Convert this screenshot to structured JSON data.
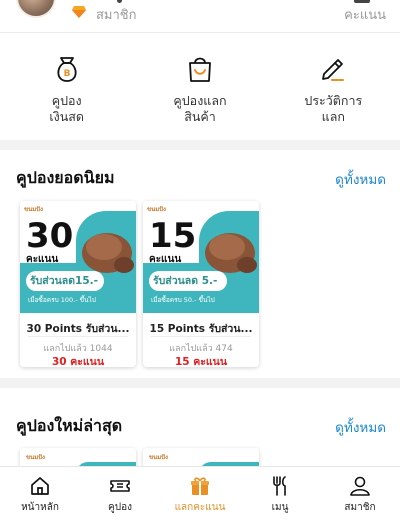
{
  "header": {
    "member_label": "สมาชิก",
    "points_label": "คะแนน"
  },
  "quick_actions": [
    {
      "line1": "คูปอง",
      "line2": "เงินสด",
      "icon": "cash-coupon-icon"
    },
    {
      "line1": "คูปองแลก",
      "line2": "สินค้า",
      "icon": "shopping-bag-icon"
    },
    {
      "line1": "ประวัติการ",
      "line2": "แลก",
      "icon": "pencil-icon"
    }
  ],
  "popular": {
    "title": "คูปองยอดนิยม",
    "see_all": "ดูทั้งหมด",
    "coupons": [
      {
        "brand": "ขนมปัง",
        "big_number": "30",
        "unit": "คะแนน",
        "discount": "รับส่วนลด15.-",
        "condition": "เมื่อซื้อครบ 100.- ขึ้นไป",
        "name": "30 Points รับส่วน...",
        "used": "แลกไปแล้ว 1044",
        "cost": "30 คะแนน"
      },
      {
        "brand": "ขนมปัง",
        "big_number": "15",
        "unit": "คะแนน",
        "discount": "รับส่วนลด 5.-",
        "condition": "เมื่อซื้อครบ 50.- ขึ้นไป",
        "name": "15 Points รับส่วน...",
        "used": "แลกไปแล้ว 474",
        "cost": "15 คะแนน"
      }
    ]
  },
  "latest": {
    "title": "คูปองใหม่ล่าสุด",
    "see_all": "ดูทั้งหมด",
    "coupons": [
      {
        "brand": "ขนมปัง"
      },
      {
        "brand": "ขนมปัง"
      }
    ]
  },
  "nav": [
    {
      "label": "หน้าหลัก",
      "icon": "home-icon",
      "active": false
    },
    {
      "label": "คูปอง",
      "icon": "ticket-icon",
      "active": false
    },
    {
      "label": "แลกคะแนน",
      "icon": "gift-icon",
      "active": true
    },
    {
      "label": "เมนู",
      "icon": "utensils-icon",
      "active": false
    },
    {
      "label": "สมาชิก",
      "icon": "user-icon",
      "active": false
    }
  ],
  "colors": {
    "accent": "#e89024",
    "link": "#1e88d3",
    "price": "#e02020",
    "teal": "#3fb6bd"
  }
}
